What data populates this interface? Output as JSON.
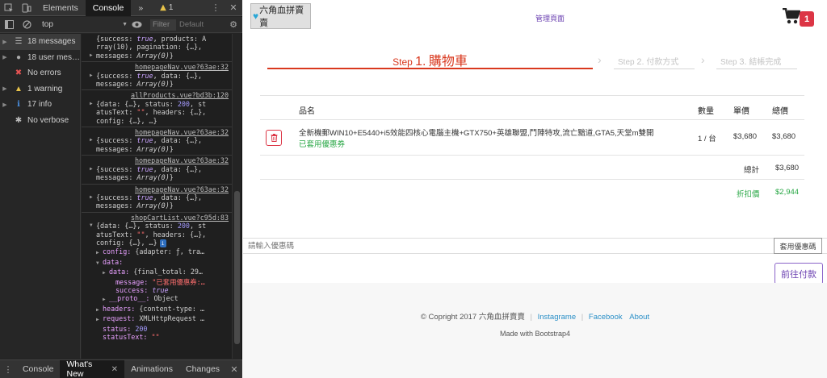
{
  "devtools": {
    "tabs": [
      "Elements",
      "Console"
    ],
    "active_tab": "Console",
    "more_tabs": "»",
    "warnings_count": "1",
    "context": "top",
    "filter_placeholder": "Filter",
    "levels": "Default",
    "sidebar": [
      {
        "label": "18 messages",
        "icon": "list-icon"
      },
      {
        "label": "18 user mes…",
        "icon": "user-icon"
      },
      {
        "label": "No errors",
        "icon": "error-icon"
      },
      {
        "label": "1 warning",
        "icon": "warning-icon"
      },
      {
        "label": "17 info",
        "icon": "info-icon"
      },
      {
        "label": "No verbose",
        "icon": "verbose-icon"
      }
    ],
    "console": {
      "top_lines": [
        "{success: true, products: A",
        "rray(10), pagination: {…},",
        "messages: Array(0)}"
      ],
      "messages": [
        {
          "src": "homepageNav.vue?63ae:32",
          "lines": [
            "{success: true, data: {…},",
            "messages: Array(0)}"
          ]
        },
        {
          "src": "allProducts.vue?bd3b:120",
          "lines": [
            "{data: {…}, status: 200, st",
            "atusText: \"\", headers: {…},",
            "config: {…}, …}"
          ]
        },
        {
          "src": "homepageNav.vue?63ae:32",
          "lines": [
            "{success: true, data: {…},",
            "messages: Array(0)}"
          ]
        },
        {
          "src": "homepageNav.vue?63ae:32",
          "lines": [
            "{success: true, data: {…},",
            "messages: Array(0)}"
          ]
        },
        {
          "src": "homepageNav.vue?63ae:32",
          "lines": [
            "{success: true, data: {…},",
            "messages: Array(0)}"
          ]
        }
      ],
      "last_src": "shopCartList.vue?c95d:83",
      "last_lines": [
        "{data: {…}, status: 200, st",
        "atusText: \"\", headers: {…},",
        "config: {…}, …}"
      ],
      "info_badge": "i",
      "object_lines": [
        {
          "indent": 1,
          "text": "config: {adapter: ƒ, tra…",
          "toggle": "closed"
        },
        {
          "indent": 1,
          "text": "data:",
          "toggle": "open"
        },
        {
          "indent": 2,
          "text": "data: {final_total: 29…",
          "toggle": "closed"
        },
        {
          "indent": 3,
          "text": "message: \"已套用優惠券:…",
          "toggle": "none"
        },
        {
          "indent": 3,
          "text": "success: true",
          "toggle": "none"
        },
        {
          "indent": 2,
          "text": "__proto__: Object",
          "toggle": "closed"
        },
        {
          "indent": 1,
          "text": "headers: {content-type: …",
          "toggle": "closed"
        },
        {
          "indent": 1,
          "text": "request: XMLHttpRequest …",
          "toggle": "closed"
        },
        {
          "indent": 1,
          "text": "status: 200",
          "toggle": "none"
        },
        {
          "indent": 1,
          "text": "statusText: \"\"",
          "toggle": "none"
        }
      ]
    },
    "drawer_tabs": [
      "Console",
      "What's New",
      "Animations",
      "Changes"
    ],
    "drawer_active": "What's New"
  },
  "page": {
    "brand": "六角血拼賣賣",
    "admin_link": "管理頁面",
    "cart_count": "1",
    "steps": [
      {
        "prefix": "Step",
        "num": "1.",
        "label": "購物車"
      },
      {
        "prefix": "Step",
        "num": "2.",
        "label": "付款方式"
      },
      {
        "prefix": "Step",
        "num": "3.",
        "label": "結帳完成"
      }
    ],
    "table_headers": {
      "name": "品名",
      "qty": "數量",
      "unit_price": "單價",
      "total": "總價"
    },
    "item": {
      "name": "全新機郵WIN10+E5440+i5效能四核心電腦主機+GTX750+英雄聯盟,鬥陣特攻,流亡黯道,GTA5,天堂m雙開",
      "coupon_note": "已套用優惠券",
      "qty": "1 / 台",
      "unit_price": "$3,680",
      "total": "$3,680"
    },
    "subtotal_label": "總計",
    "subtotal_value": "$3,680",
    "discount_label": "折扣價",
    "discount_value": "$2,944",
    "coupon_placeholder": "請輸入優惠碼",
    "coupon_button": "套用優惠碼",
    "checkout_button": "前往付款",
    "footer": {
      "copyright": "© Copright 2017 六角血拼賣賣",
      "links": [
        "Instagrame",
        "Facebook",
        "About"
      ],
      "made_with": "Made with Bootstrap4"
    },
    "colors": {
      "accent": "#d9381e",
      "success": "#28a745",
      "danger": "#dc3545",
      "link": "#2a8fc7",
      "purple": "#6a3fb0"
    }
  }
}
